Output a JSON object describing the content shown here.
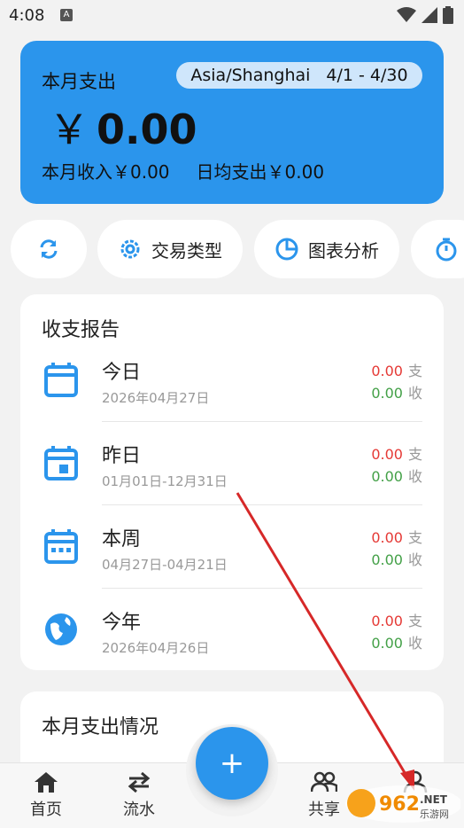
{
  "status_bar": {
    "time": "4:08",
    "notif_icon_letter": "A"
  },
  "summary": {
    "title": "本月支出",
    "timezone": "Asia/Shanghai",
    "range": "4/1 - 4/30",
    "currency": "￥",
    "amount": "0.00",
    "income_label": "本月收入￥0.00",
    "daily_label": "日均支出￥0.00",
    "accent_color": "#2b95ec"
  },
  "quick_actions": [
    {
      "icon": "refresh-icon",
      "label": ""
    },
    {
      "icon": "gear-icon",
      "label": "交易类型"
    },
    {
      "icon": "pie-chart-icon",
      "label": "图表分析"
    },
    {
      "icon": "timer-icon",
      "label": ""
    }
  ],
  "report": {
    "title": "收支报告",
    "rows": [
      {
        "name": "今日",
        "date": "2026年04月27日",
        "out": "0.00",
        "out_label": "支",
        "in": "0.00",
        "in_label": "收",
        "icon": "calendar-icon"
      },
      {
        "name": "昨日",
        "date": "01月01日-12月31日",
        "out": "0.00",
        "out_label": "支",
        "in": "0.00",
        "in_label": "收",
        "icon": "calendar-day-icon"
      },
      {
        "name": "本周",
        "date": "04月27日-04月21日",
        "out": "0.00",
        "out_label": "支",
        "in": "0.00",
        "in_label": "收",
        "icon": "calendar-week-icon"
      },
      {
        "name": "今年",
        "date": "2026年04月26日",
        "out": "0.00",
        "out_label": "支",
        "in": "0.00",
        "in_label": "收",
        "icon": "globe-icon"
      }
    ]
  },
  "monthly": {
    "title": "本月支出情况"
  },
  "nav": {
    "home": "首页",
    "flow": "流水",
    "share": "共享",
    "fab": "+"
  },
  "watermark": {
    "text": "962.NET",
    "sub": "乐游网"
  },
  "colors": {
    "expense": "#e53935",
    "income": "#43a047",
    "primary": "#2b95ec"
  }
}
